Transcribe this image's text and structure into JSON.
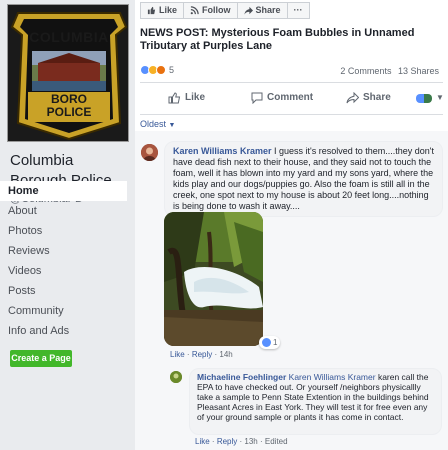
{
  "page": {
    "name": "Columbia Borough Police",
    "handle": "@ColumbiaPD",
    "logo": {
      "top_text": "COLUMBIA",
      "bottom_text_1": "BORO",
      "bottom_text_2": "POLICE"
    }
  },
  "nav": {
    "items": [
      {
        "label": "Home",
        "active": true
      },
      {
        "label": "About"
      },
      {
        "label": "Photos"
      },
      {
        "label": "Reviews"
      },
      {
        "label": "Videos"
      },
      {
        "label": "Posts"
      },
      {
        "label": "Community"
      },
      {
        "label": "Info and Ads"
      }
    ],
    "create_page": "Create a Page"
  },
  "action_bar": {
    "like": "Like",
    "follow": "Follow",
    "share": "Share",
    "more": "···"
  },
  "post": {
    "title": "NEWS POST: Mysterious Foam Bubbles in Unnamed Tributary at Purples Lane",
    "reaction_count": "5",
    "comments": "2 Comments",
    "shares": "13 Shares",
    "actions": {
      "like": "Like",
      "comment": "Comment",
      "share": "Share"
    },
    "sort": "Oldest"
  },
  "comments": [
    {
      "author": "Karen Williams Kramer",
      "text": "I guess it's resolved to them....they don't have dead fish next to their house, and they said not to touch the foam, well it has blown into my yard and my sons yard, where the kids play and our dogs/puppies go. Also the foam is still all in the creek, one spot next to my house is about 20 feet long....nothing is being done to wash it away....",
      "like": "Like",
      "reply": "Reply",
      "time": "14h",
      "likes": "1"
    },
    {
      "author": "Michaeline Foehlinger",
      "mention": "Karen Williams Kramer",
      "text": "karen call the EPA to have checked out. Or yourself /neighbors physicallly take a sample to Penn State Extention in the buildings behind Pleasant Acres in East York. They will test it for free even any of your ground sample or plants it has come in contact.",
      "like": "Like",
      "reply": "Reply",
      "time": "13h",
      "edited": "Edited"
    }
  ],
  "colors": {
    "fb_blue": "#385898",
    "green": "#42b72a",
    "gold": "#c9a227"
  }
}
